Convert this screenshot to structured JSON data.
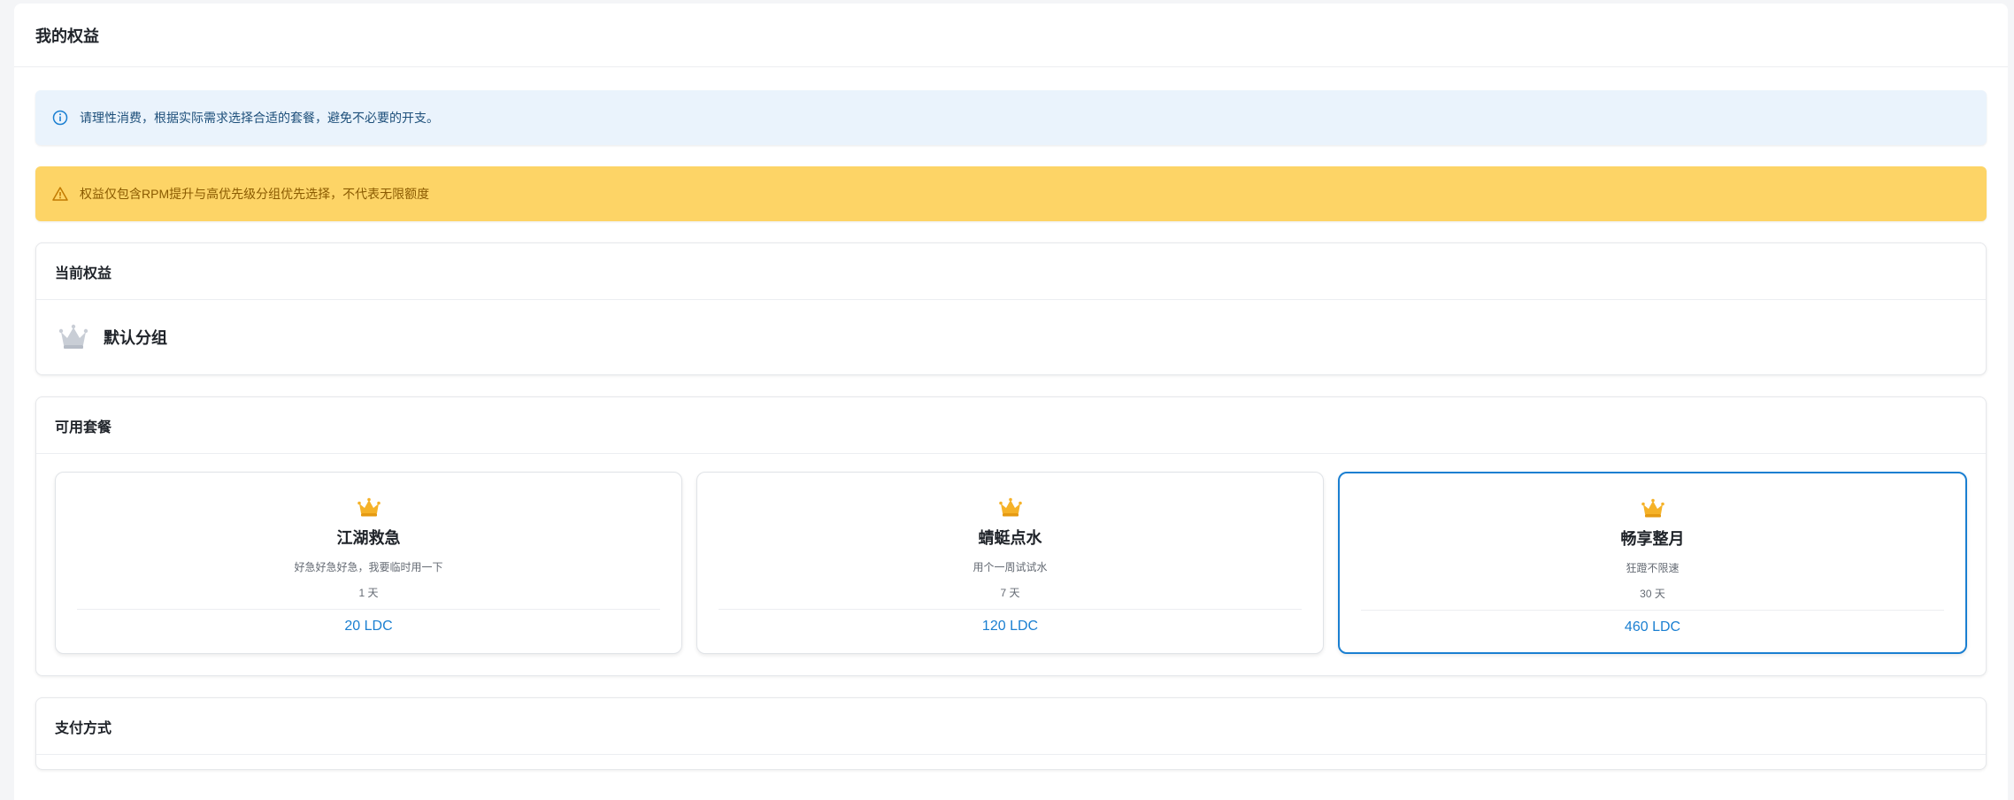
{
  "page": {
    "title": "我的权益"
  },
  "alerts": {
    "info": "请理性消费，根据实际需求选择合适的套餐，避免不必要的开支。",
    "warning": "权益仅包含RPM提升与高优先级分组优先选择，不代表无限额度"
  },
  "current": {
    "header": "当前权益",
    "group_name": "默认分组",
    "icon": "crown-icon"
  },
  "plans": {
    "header": "可用套餐",
    "items": [
      {
        "name": "江湖救急",
        "desc": "好急好急好急，我要临时用一下",
        "duration": "1 天",
        "price": "20 LDC",
        "selected": false
      },
      {
        "name": "蜻蜓点水",
        "desc": "用个一周试试水",
        "duration": "7 天",
        "price": "120 LDC",
        "selected": false
      },
      {
        "name": "畅享整月",
        "desc": "狂蹬不限速",
        "duration": "30 天",
        "price": "460 LDC",
        "selected": true
      }
    ]
  },
  "payment": {
    "header": "支付方式"
  },
  "colors": {
    "accent": "#1a7fd1",
    "info_bg": "#eaf3fc",
    "warning_bg": "#fdd466",
    "crown_gold": "#f5b228"
  }
}
